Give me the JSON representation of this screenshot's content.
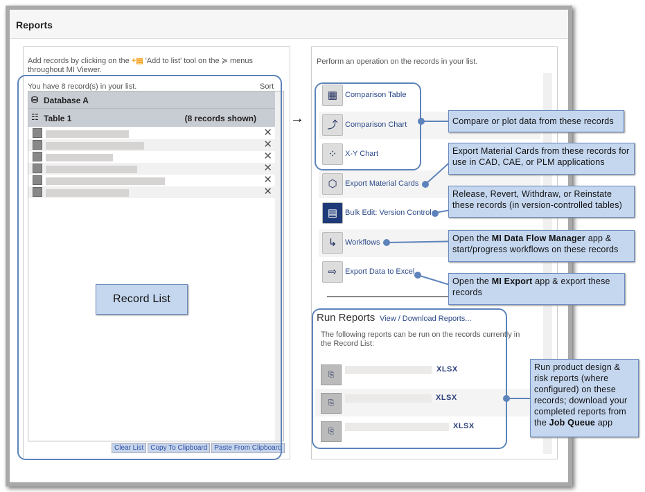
{
  "header": {
    "title": "Reports"
  },
  "left": {
    "hint_pre": "Add records by clicking on the",
    "hint_mid": "'Add to list' tool on the",
    "hint_post": "menus throughout MI Viewer.",
    "count_text": "You have 8 record(s) in your list.",
    "sort_label": "Sort",
    "database": "Database A",
    "table": "Table 1",
    "records_shown": "(8 records shown)",
    "buttons": {
      "clear": "Clear List",
      "copy": "Copy To Clipboard",
      "paste": "Paste From Clipboard"
    },
    "record_list_label": "Record List"
  },
  "right": {
    "hint": "Perform an operation on the records in your list.",
    "operations": [
      {
        "label": "Comparison Table",
        "icon": "comparison-table-icon"
      },
      {
        "label": "Comparison Chart",
        "icon": "comparison-chart-icon"
      },
      {
        "label": "X-Y Chart",
        "icon": "xy-chart-icon"
      },
      {
        "label": "Export Material Cards",
        "icon": "export-material-cards-icon"
      },
      {
        "label": "Bulk Edit: Version Control",
        "icon": "bulk-edit-icon"
      },
      {
        "label": "Workflows",
        "icon": "workflows-icon"
      },
      {
        "label": "Export Data to Excel",
        "icon": "export-excel-icon"
      }
    ],
    "reports": {
      "title": "Run Reports",
      "link": "View / Download Reports...",
      "desc": "The following reports can be run on the records currently in the Record List:",
      "formats": [
        "XLSX",
        "XLSX",
        "XLSX"
      ]
    }
  },
  "callouts": {
    "c1": "Compare or plot data from these records",
    "c2": "Export Material Cards from these records for use in CAD, CAE, or PLM applications",
    "c3": "Release, Revert, Withdraw, or Reinstate these records (in version-controlled tables)",
    "c4_pre": "Open the",
    "c4_bold": "MI Data Flow Manager",
    "c4_post": "app & start/progress workflows on these records",
    "c5_pre": "Open the",
    "c5_bold": "MI Export",
    "c5_post": "app & export these records",
    "c6_pre": "Run product design & risk reports (where configured) on these records; download your completed reports from the",
    "c6_bold": "Job Queue",
    "c6_post": "app"
  },
  "arrow": "→"
}
